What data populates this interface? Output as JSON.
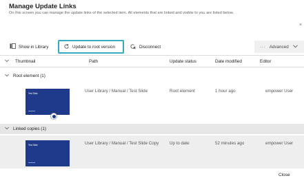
{
  "dialog": {
    "title": "Manage Update Links",
    "subtitle": "On this screen you can manage the update links of the selected item. All elements that are linked and visible to you are listed below.",
    "close_label": "Close"
  },
  "toolbar": {
    "show_in_library": "Show in Library",
    "update_to_root": "Update to root version",
    "disconnect": "Disconnect",
    "advanced": "Advanced",
    "accent_color": "#34a9c4"
  },
  "table": {
    "headers": [
      "Thumbnail",
      "Path",
      "Update status",
      "Date modified",
      "Editor"
    ],
    "groups": [
      {
        "label": "Root element (1)",
        "rows": [
          {
            "thumb_title": "Test Slide",
            "path": "User Library / Manual / Test Slide",
            "status": "Root element",
            "date": "1 hour ago",
            "editor": "empower User"
          }
        ]
      },
      {
        "label": "Linked copies (1)",
        "rows": [
          {
            "thumb_title": "Test Slide",
            "path": "User Library / Manual / Test Slide Copy",
            "status": "Up to date",
            "date": "52 minutes ago",
            "editor": "empower User"
          }
        ]
      }
    ]
  }
}
